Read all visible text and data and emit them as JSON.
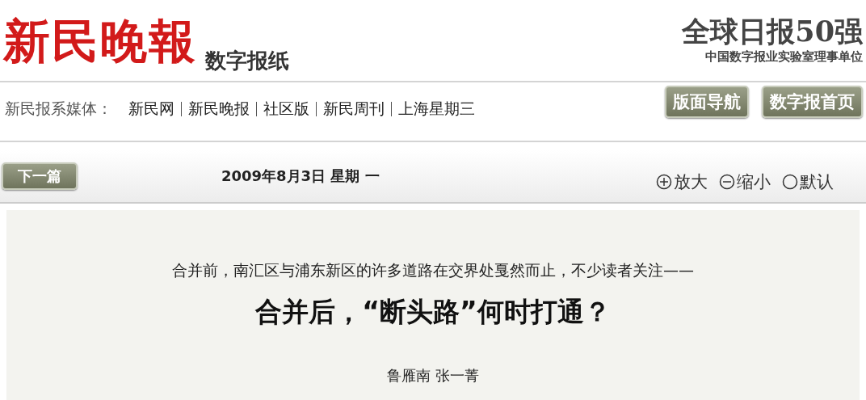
{
  "masthead": {
    "logo": "新民晚報",
    "subtitle": "数字报纸",
    "slogan": "全球日报50强",
    "tagline": "中国数字报业实验室理事单位"
  },
  "media_bar": {
    "label": "新民报系媒体：",
    "links": [
      "新民网",
      "新民晚报",
      "社区版",
      "新民周刊",
      "上海星期三"
    ],
    "buttons": [
      "版面导航",
      "数字报首页"
    ]
  },
  "toolbar": {
    "next_button": "下一篇",
    "date": "2009年8月3日 星期 一",
    "zoom": [
      {
        "kind": "plus",
        "label": "放大"
      },
      {
        "kind": "minus",
        "label": "缩小"
      },
      {
        "kind": "reset",
        "label": "默认"
      }
    ]
  },
  "article": {
    "kicker": "合并前，南汇区与浦东新区的许多道路在交界处戛然而止，不少读者关注——",
    "headline": "合并后，“断头路”何时打通？",
    "authors": "鲁雁南 张一菁"
  }
}
